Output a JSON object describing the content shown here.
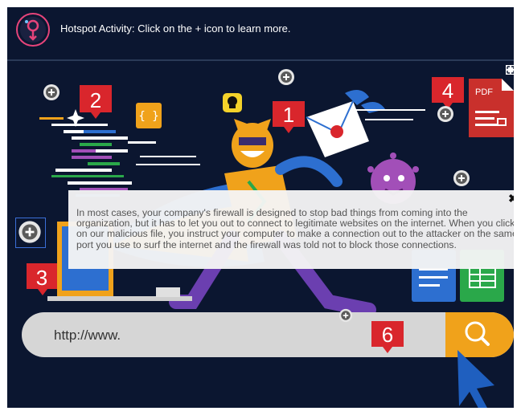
{
  "header": {
    "title": "Hotspot Activity: Click on the + icon to learn more."
  },
  "hotspots": [
    {
      "number": "1"
    },
    {
      "number": "2"
    },
    {
      "number": "3"
    },
    {
      "number": "4"
    },
    {
      "number": "6"
    }
  ],
  "illustration": {
    "pdf_label": "PDF",
    "code_braces": "{ }",
    "url_text": "http://www."
  },
  "popup": {
    "text": "In most cases, your company's firewall is designed to stop bad things from coming into the organization, but it has to let you out to connect to legitimate websites on the internet. When you click on our malicious file, you instruct your computer to make a connection out to the attacker on the same port you use to surf the internet and the firewall was told not to block those connections.",
    "close_label": "✖"
  },
  "colors": {
    "background": "#0b1630",
    "hotspot_red": "#d9262c",
    "search_orange": "#f0a21b",
    "cursor_blue": "#1f5fbf",
    "pdf_red": "#c9302c",
    "sheet_green": "#2aa84a",
    "doc_blue": "#2d6fd0",
    "virus_purple": "#a24fb8"
  }
}
